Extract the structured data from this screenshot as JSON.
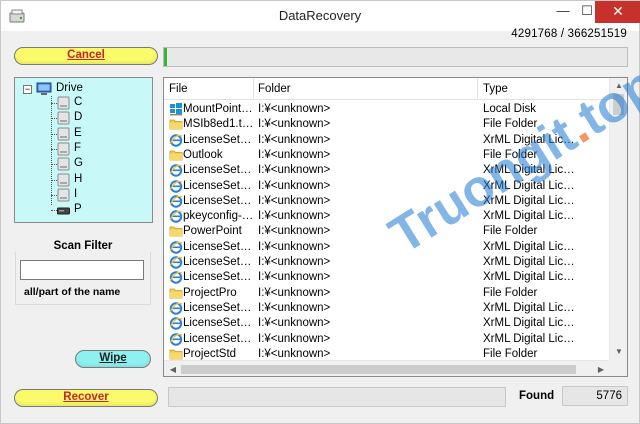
{
  "window": {
    "title": "DataRecovery",
    "controls": {
      "minimize": "—",
      "maximize": "☐",
      "close": "✕"
    }
  },
  "counter": "4291768  /  366251519",
  "buttons": {
    "cancel": "Cancel",
    "wipe": "Wipe",
    "recover": "Recover"
  },
  "scan_progress": 0.006,
  "drive_tree": {
    "root": "Drive",
    "items": [
      "C",
      "D",
      "E",
      "F",
      "G",
      "H",
      "I",
      "P"
    ]
  },
  "scan_filter": {
    "title": "Scan Filter",
    "value": "",
    "hint": "all/part of the name"
  },
  "table": {
    "headers": {
      "file": "File",
      "folder": "Folder",
      "type": "Type"
    },
    "rows": [
      {
        "icon": "windows-icon",
        "file": "MountPoint…",
        "folder": "I:¥<unknown>",
        "type": "Local Disk"
      },
      {
        "icon": "folder-icon",
        "file": "MSIb8ed1.t…",
        "folder": "I:¥<unknown>",
        "type": "File Folder"
      },
      {
        "icon": "ie-icon",
        "file": "LicenseSet…",
        "folder": "I:¥<unknown>",
        "type": "XrML Digital Lic…"
      },
      {
        "icon": "folder-icon",
        "file": "Outlook",
        "folder": "I:¥<unknown>",
        "type": "File Folder"
      },
      {
        "icon": "ie-icon",
        "file": "LicenseSet…",
        "folder": "I:¥<unknown>",
        "type": "XrML Digital Lic…"
      },
      {
        "icon": "ie-icon",
        "file": "LicenseSet…",
        "folder": "I:¥<unknown>",
        "type": "XrML Digital Lic…"
      },
      {
        "icon": "ie-icon",
        "file": "LicenseSet…",
        "folder": "I:¥<unknown>",
        "type": "XrML Digital Lic…"
      },
      {
        "icon": "ie-icon",
        "file": "pkeyconfig-…",
        "folder": "I:¥<unknown>",
        "type": "XrML Digital Lic…"
      },
      {
        "icon": "folder-icon",
        "file": "PowerPoint",
        "folder": "I:¥<unknown>",
        "type": "File Folder"
      },
      {
        "icon": "ie-icon",
        "file": "LicenseSet…",
        "folder": "I:¥<unknown>",
        "type": "XrML Digital Lic…"
      },
      {
        "icon": "ie-icon",
        "file": "LicenseSet…",
        "folder": "I:¥<unknown>",
        "type": "XrML Digital Lic…"
      },
      {
        "icon": "ie-icon",
        "file": "LicenseSet…",
        "folder": "I:¥<unknown>",
        "type": "XrML Digital Lic…"
      },
      {
        "icon": "folder-icon",
        "file": "ProjectPro",
        "folder": "I:¥<unknown>",
        "type": "File Folder"
      },
      {
        "icon": "ie-icon",
        "file": "LicenseSet…",
        "folder": "I:¥<unknown>",
        "type": "XrML Digital Lic…"
      },
      {
        "icon": "ie-icon",
        "file": "LicenseSet…",
        "folder": "I:¥<unknown>",
        "type": "XrML Digital Lic…"
      },
      {
        "icon": "ie-icon",
        "file": "LicenseSet…",
        "folder": "I:¥<unknown>",
        "type": "XrML Digital Lic…"
      },
      {
        "icon": "folder-icon",
        "file": "ProjectStd",
        "folder": "I:¥<unknown>",
        "type": "File Folder"
      }
    ]
  },
  "found": {
    "label": "Found",
    "value": "5776"
  },
  "watermark": {
    "main": "Truongit",
    "dot": ".",
    "tld": "top"
  },
  "colors": {
    "yellow_button": "#fafa6b",
    "cyan_button": "#8ff0f0",
    "tree_background": "#c8f8f8",
    "progress_green": "#36b536",
    "close_red": "#c7312c"
  }
}
